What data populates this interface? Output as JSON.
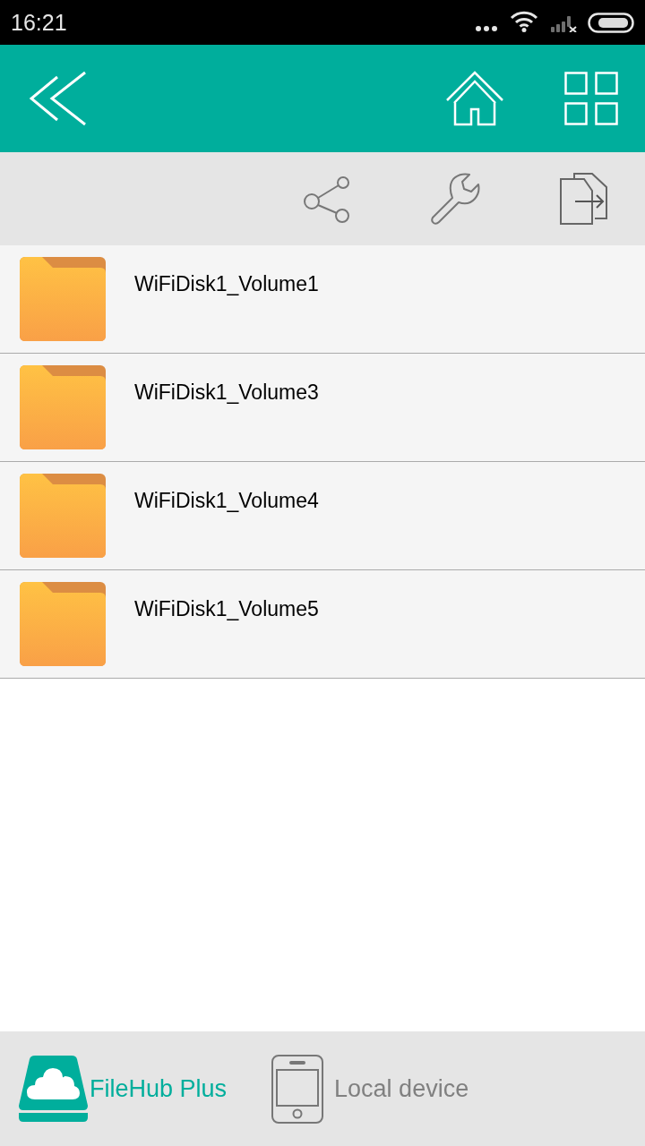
{
  "status_bar": {
    "time": "16:21"
  },
  "folders": [
    {
      "name": "WiFiDisk1_Volume1"
    },
    {
      "name": "WiFiDisk1_Volume3"
    },
    {
      "name": "WiFiDisk1_Volume4"
    },
    {
      "name": "WiFiDisk1_Volume5"
    }
  ],
  "bottom_tabs": [
    {
      "label": "FileHub Plus",
      "kind": "cloud-drive",
      "selected": true
    },
    {
      "label": "Local device",
      "kind": "phone",
      "selected": false
    }
  ]
}
